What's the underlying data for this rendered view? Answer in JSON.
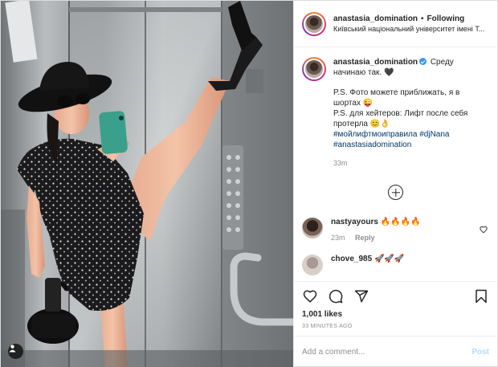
{
  "header": {
    "username": "anastasia_domination",
    "separator": "•",
    "follow_label": "Following",
    "location": "Київський національний університет імені Т..."
  },
  "caption": {
    "username": "anastasia_domination",
    "line1": "Среду начинаю так. 🖤",
    "line2": "P.S. Фото можете приближать, я в шортах 😜",
    "line3": "P.S. для хейтеров: Лифт после себя протерла 😊👌",
    "hashtags": "#мойлифтмоиправила #djNana #anastasiadomination",
    "time": "33m"
  },
  "comments": [
    {
      "username": "nastyayours",
      "text": "🔥🔥🔥🔥",
      "time": "23m",
      "reply_label": "Reply"
    },
    {
      "username": "chove_985",
      "text": "🚀🚀🚀",
      "time": "",
      "reply_label": ""
    }
  ],
  "likes": "1,001 likes",
  "posted": "33 MINUTES AGO",
  "add_comment": {
    "placeholder": "Add a comment...",
    "post_label": "Post"
  },
  "colors": {
    "link": "#00376b",
    "verified": "#3897f0",
    "post_disabled": "#b2dffc",
    "muted": "#8e8e8e"
  },
  "icons": [
    "heart-icon",
    "comment-icon",
    "share-icon",
    "bookmark-icon",
    "add-comments-icon",
    "verified-badge-icon",
    "user-tag-icon"
  ]
}
